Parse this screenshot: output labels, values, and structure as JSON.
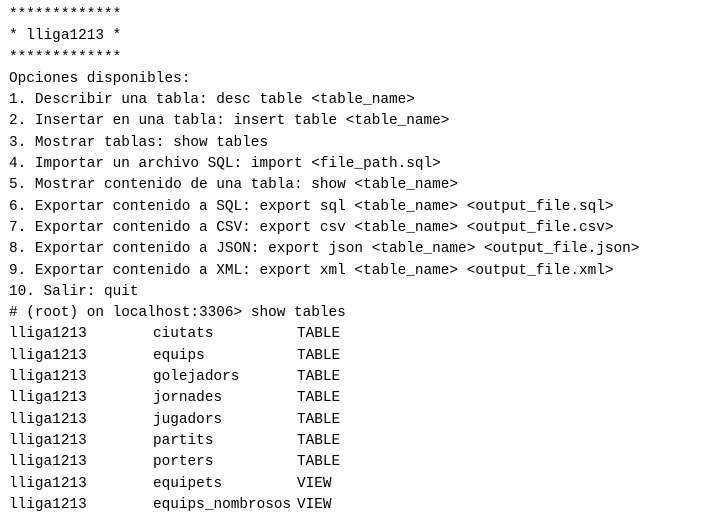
{
  "terminal": {
    "banner": [
      "*************",
      "* lliga1213 *",
      "*************"
    ],
    "menu_heading": "Opciones disponibles:",
    "menu_options": [
      "1. Describir una tabla: desc table <table_name>",
      "2. Insertar en una tabla: insert table <table_name>",
      "3. Mostrar tablas: show tables",
      "4. Importar un archivo SQL: import <file_path.sql>",
      "5. Mostrar contenido de una tabla: show <table_name>",
      "6. Exportar contenido a SQL: export sql <table_name> <output_file.sql>",
      "7. Exportar contenido a CSV: export csv <table_name> <output_file.csv>",
      "8. Exportar contenido a JSON: export json <table_name> <output_file.json>",
      "9. Exportar contenido a XML: export xml <table_name> <output_file.xml>",
      "10. Salir: quit"
    ],
    "prompt": "# (root) on localhost:3306> ",
    "command": "show tables",
    "results": [
      {
        "database": "lliga1213",
        "name": "ciutats",
        "type": "TABLE"
      },
      {
        "database": "lliga1213",
        "name": "equips",
        "type": "TABLE"
      },
      {
        "database": "lliga1213",
        "name": "golejadors",
        "type": "TABLE"
      },
      {
        "database": "lliga1213",
        "name": "jornades",
        "type": "TABLE"
      },
      {
        "database": "lliga1213",
        "name": "jugadors",
        "type": "TABLE"
      },
      {
        "database": "lliga1213",
        "name": "partits",
        "type": "TABLE"
      },
      {
        "database": "lliga1213",
        "name": "porters",
        "type": "TABLE"
      },
      {
        "database": "lliga1213",
        "name": "equipets",
        "type": "VIEW"
      },
      {
        "database": "lliga1213",
        "name": "equips_nombrosos",
        "type": "VIEW"
      }
    ]
  }
}
